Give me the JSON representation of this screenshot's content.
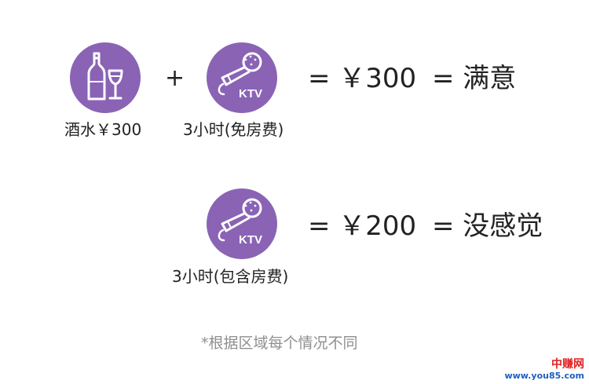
{
  "row1": {
    "item1_label": "酒水￥300",
    "plus": "+",
    "item2_badge": "KTV",
    "item2_label": "3小时(免房费)",
    "equals_price": "= ￥300",
    "equals_feeling": "= 满意"
  },
  "row2": {
    "item_badge": "KTV",
    "item_label": "3小时(包含房费)",
    "equals_price": "= ￥200",
    "equals_feeling": "= 没感觉"
  },
  "note": "*根据区域每个情况不同",
  "watermark": {
    "title": "中赚网",
    "url": "www.you85.com"
  },
  "colors": {
    "icon_circle": "#8a63b5",
    "icon_line": "#ffffff",
    "text": "#222222",
    "note": "#8f8f8f",
    "watermark_title": "#e02020",
    "watermark_url": "#1e5fbf"
  },
  "icons": {
    "drinks": "wine-bottle-and-glass-icon",
    "karaoke": "ktv-microphone-icon"
  }
}
